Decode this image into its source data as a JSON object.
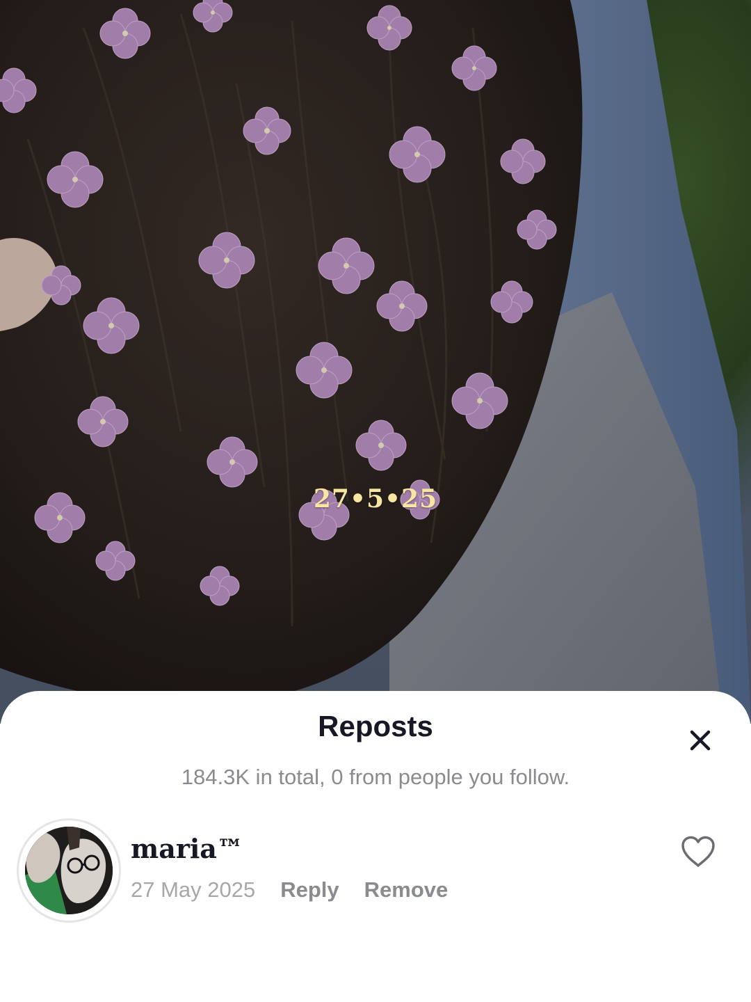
{
  "photo": {
    "overlay_text": "27•5•25"
  },
  "sheet": {
    "title": "Reposts",
    "subtitle": "184.3K in total, 0 from people you follow.",
    "close_icon": "close-icon"
  },
  "reposts": [
    {
      "username": "maria™",
      "date": "27 May 2025",
      "reply_label": "Reply",
      "remove_label": "Remove",
      "like_icon": "heart-outline-icon"
    }
  ],
  "colors": {
    "title": "#161823",
    "secondary_text": "#8a8b91",
    "overlay_text": "#f6e6a2",
    "flower": "#b88fc2"
  }
}
